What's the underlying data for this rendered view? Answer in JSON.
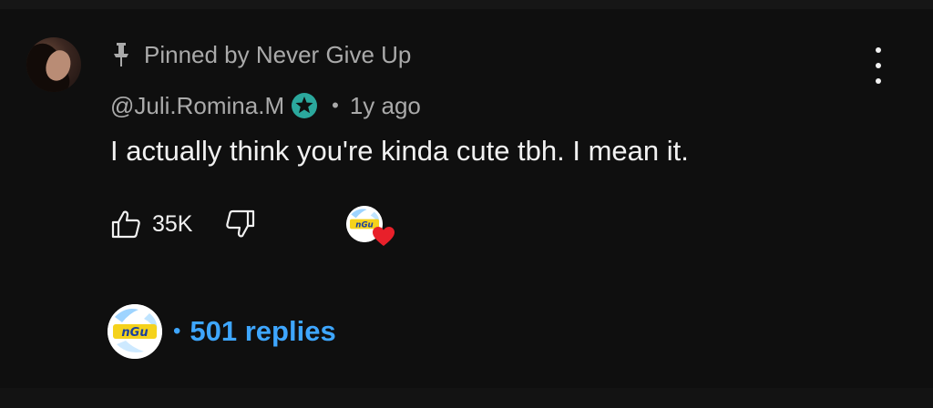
{
  "comment": {
    "pinned_label": "Pinned by Never Give Up",
    "author": "@Juli.Romina.M",
    "separator": "•",
    "age": "1y ago",
    "text": "I actually think you're kinda cute tbh. I mean it.",
    "like_count": "35K",
    "replies_separator": "•",
    "replies_label": "501 replies",
    "creator_logo_text": "nGu"
  },
  "icons": {
    "pin": "pin-icon",
    "member_badge": "star-badge-icon",
    "like": "thumbs-up-icon",
    "dislike": "thumbs-down-icon",
    "heart": "heart-icon",
    "more": "more-vertical-icon"
  },
  "colors": {
    "background": "#0f0f0f",
    "text_primary": "#f1f1f1",
    "text_secondary": "#aaaaaa",
    "link_blue": "#3ea6ff",
    "badge_teal": "#2ba89d",
    "heart_red": "#e8202a"
  }
}
